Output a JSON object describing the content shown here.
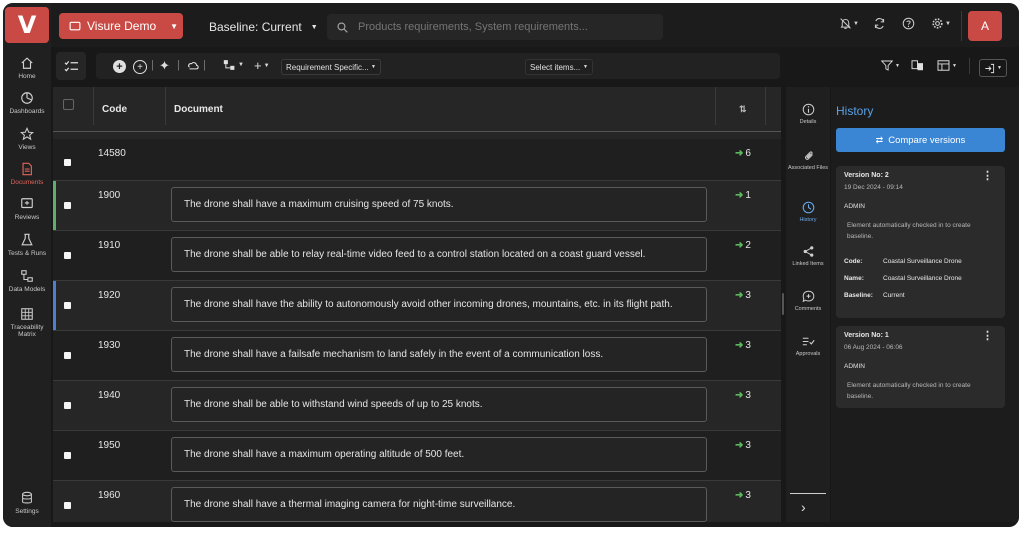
{
  "app": {
    "logo": "V"
  },
  "nav": [
    {
      "label": "Home",
      "icon": "home-icon"
    },
    {
      "label": "Dashboards",
      "icon": "dashboard-icon"
    },
    {
      "label": "Views",
      "icon": "star-icon"
    },
    {
      "label": "Documents",
      "icon": "document-icon",
      "active": true
    },
    {
      "label": "Reviews",
      "icon": "review-icon"
    },
    {
      "label": "Tests & Runs",
      "icon": "flask-icon"
    },
    {
      "label": "Data Models",
      "icon": "data-model-icon"
    },
    {
      "label": "Traceability Matrix",
      "icon": "matrix-icon"
    },
    {
      "label": "Settings",
      "icon": "database-icon"
    }
  ],
  "header": {
    "project": "Visure Demo",
    "baseline": "Baseline: Current",
    "search_placeholder": "Products requirements, System requirements...",
    "avatar": "A"
  },
  "toolbar": {
    "spec_dropdown": "Requirement Specific...",
    "select_dropdown": "Select items..."
  },
  "table": {
    "columns": [
      "Code",
      "Document"
    ],
    "rows": [
      {
        "code": "14580",
        "text": "",
        "links": "6",
        "marker": ""
      },
      {
        "code": "1900",
        "text": "The drone shall have a maximum cruising speed of 75 knots.",
        "links": "1",
        "marker": "#5fae6e"
      },
      {
        "code": "1910",
        "text": "The drone shall be able to relay real-time video feed to a control station located on a coast guard vessel.",
        "links": "2",
        "marker": ""
      },
      {
        "code": "1920",
        "text": "The drone shall have the ability to autonomously avoid other incoming drones, mountains, etc. in its flight path.",
        "links": "3",
        "marker": "#4d7fd0"
      },
      {
        "code": "1930",
        "text": "The drone shall have a failsafe mechanism to land safely in the event of a communication loss.",
        "links": "3",
        "marker": ""
      },
      {
        "code": "1940",
        "text": "The drone shall be able to withstand wind speeds of up to 25 knots.",
        "links": "3",
        "marker": ""
      },
      {
        "code": "1950",
        "text": "The drone shall have a maximum operating altitude of 500 feet.",
        "links": "3",
        "marker": ""
      },
      {
        "code": "1960",
        "text": "The drone shall have a thermal imaging camera for night-time surveillance.",
        "links": "3",
        "marker": ""
      }
    ]
  },
  "rail": [
    {
      "label": "Details",
      "icon": "info-icon"
    },
    {
      "label": "Associated Files",
      "icon": "paperclip-icon"
    },
    {
      "label": "History",
      "icon": "clock-icon",
      "active": true
    },
    {
      "label": "Linked Items",
      "icon": "share-icon"
    },
    {
      "label": "Comments",
      "icon": "comment-icon"
    },
    {
      "label": "Approvals",
      "icon": "approval-icon"
    }
  ],
  "history": {
    "title": "History",
    "compare_label": "Compare versions",
    "versions": [
      {
        "title": "Version No: 2",
        "date": "19 Dec 2024 - 09:14",
        "user": "ADMIN",
        "message": "Element automatically checked in to create baseline.",
        "code_label": "Code:",
        "code": "Coastal Surveillance Drone",
        "name_label": "Name:",
        "name": "Coastal Surveillance Drone",
        "baseline_label": "Baseline:",
        "baseline": "Current"
      },
      {
        "title": "Version No: 1",
        "date": "06 Aug 2024 - 06:06",
        "user": "ADMIN",
        "message": "Element automatically checked in to create baseline."
      }
    ]
  }
}
